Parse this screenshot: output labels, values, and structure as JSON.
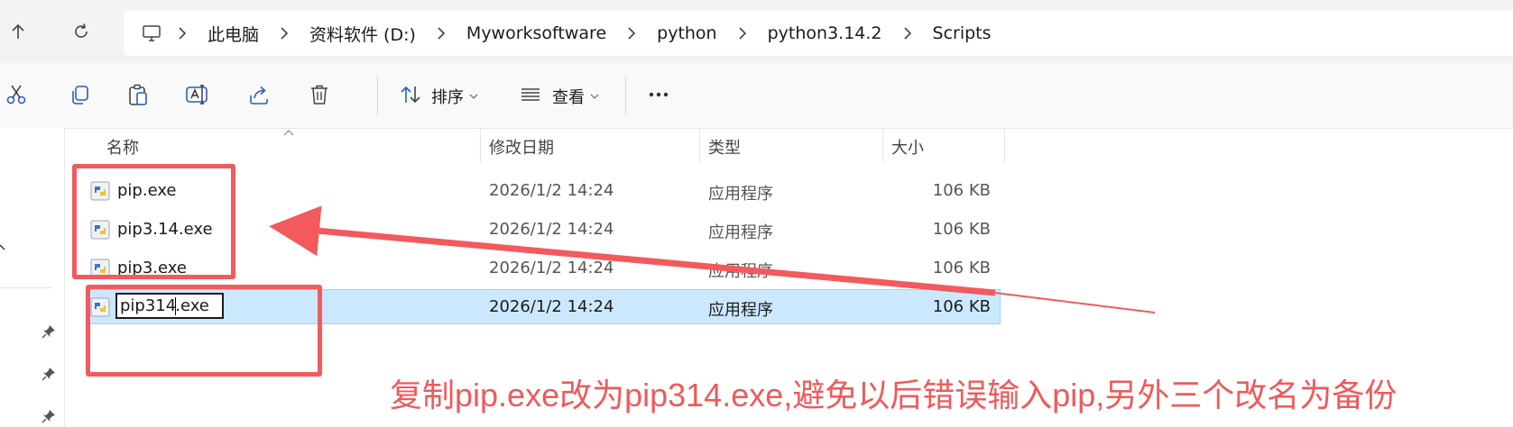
{
  "address": {
    "breadcrumbs": [
      "此电脑",
      "资料软件 (D:)",
      "Myworksoftware",
      "python",
      "python3.14.2",
      "Scripts"
    ]
  },
  "toolbar": {
    "sort_label": "排序",
    "view_label": "查看"
  },
  "columns": {
    "name": "名称",
    "modified": "修改日期",
    "type": "类型",
    "size": "大小"
  },
  "files": [
    {
      "name": "pip.exe",
      "modified": "2026/1/2 14:24",
      "type": "应用程序",
      "size": "106 KB"
    },
    {
      "name": "pip3.14.exe",
      "modified": "2026/1/2 14:24",
      "type": "应用程序",
      "size": "106 KB"
    },
    {
      "name": "pip3.exe",
      "modified": "2026/1/2 14:24",
      "type": "应用程序",
      "size": "106 KB"
    },
    {
      "name_before_caret": "pip314",
      "name_after_caret": ".exe",
      "modified": "2026/1/2 14:24",
      "type": "应用程序",
      "size": "106 KB"
    }
  ],
  "annotation": {
    "text": "复制pip.exe改为pip314.exe,避免以后错误输入pip,另外三个改名为备份",
    "color": "#ef5a5a"
  },
  "colors": {
    "selection": "#cce8ff",
    "annotation_red": "#f25a5e"
  }
}
